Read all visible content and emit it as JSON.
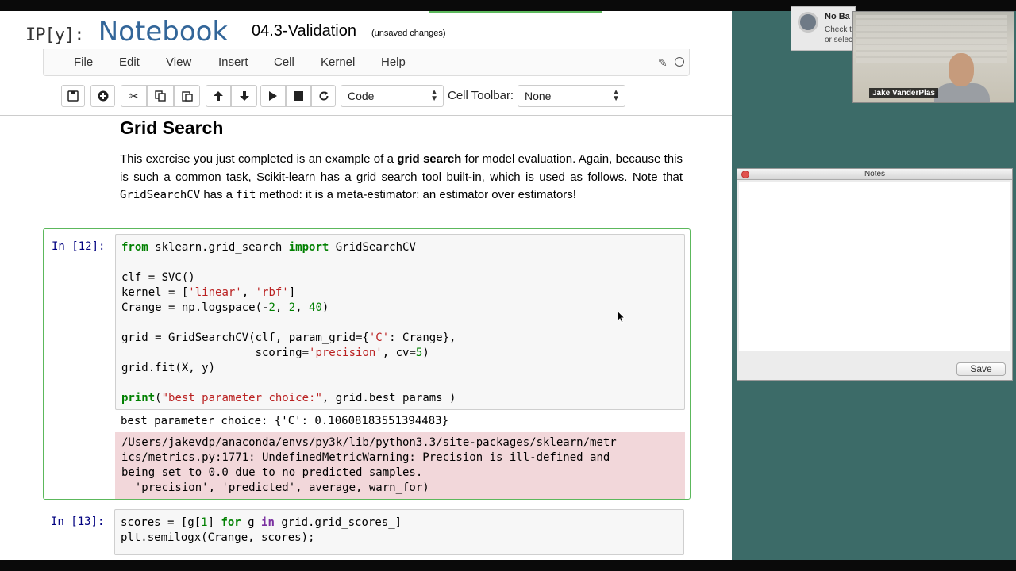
{
  "notebook": {
    "logo_ipy": "IP[y]:",
    "logo_word": "Notebook",
    "name": "04.3-Validation",
    "status": "(unsaved changes)"
  },
  "menu": [
    "File",
    "Edit",
    "View",
    "Insert",
    "Cell",
    "Kernel",
    "Help"
  ],
  "toolbar": {
    "cell_type": "Code",
    "cell_toolbar_label": "Cell Toolbar:",
    "cell_toolbar_value": "None"
  },
  "markdown": {
    "heading": "Grid Search",
    "p1_a": "This exercise you just completed is an example of a ",
    "p1_b": "grid search",
    "p1_c": " for model evaluation. Again, because this is such a common task, Scikit-learn has a grid search tool built-in, which is used as follows. Note that ",
    "p1_d": "GridSearchCV",
    "p1_e": " has a ",
    "p1_f": "fit",
    "p1_g": " method: it is a meta-estimator: an estimator over estimators!"
  },
  "cell12": {
    "prompt": "In [12]:",
    "l1_kw": "from",
    "l1_a": " sklearn.grid_search ",
    "l1_kw2": "import",
    "l1_b": " GridSearchCV",
    "l3": "clf = SVC()",
    "l4_a": "kernel = [",
    "l4_s1": "'linear'",
    "l4_b": ", ",
    "l4_s2": "'rbf'",
    "l4_c": "]",
    "l5_a": "Crange = np.logspace(-",
    "l5_n1": "2",
    "l5_b": ", ",
    "l5_n2": "2",
    "l5_c": ", ",
    "l5_n3": "40",
    "l5_d": ")",
    "l7_a": "grid = GridSearchCV(clf, param_grid={",
    "l7_s": "'C'",
    "l7_b": ": Crange},",
    "l8_a": "                    scoring=",
    "l8_s": "'precision'",
    "l8_b": ", cv=",
    "l8_n": "5",
    "l8_c": ")",
    "l9": "grid.fit(X, y)",
    "l11_kw": "print",
    "l11_a": "(",
    "l11_s": "\"best parameter choice:\"",
    "l11_b": ", grid.best_params_)",
    "output": "best parameter choice: {'C': 0.10608183551394483}",
    "stderr": [
      "/Users/jakevdp/anaconda/envs/py3k/lib/python3.3/site-packages/sklearn/metr",
      "ics/metrics.py:1771: UndefinedMetricWarning: Precision is ill-defined and",
      "being set to 0.0 due to no predicted samples.",
      "  'precision', 'predicted', average, warn_for)"
    ]
  },
  "cell13": {
    "prompt": "In [13]:",
    "l1_a": "scores = [g[",
    "l1_n": "1",
    "l1_b": "] ",
    "l1_kw": "for",
    "l1_c": " g ",
    "l1_kw2": "in",
    "l1_d": " grid.grid_scores_]",
    "l2": "plt.semilogx(Crange, scores);"
  },
  "notification": {
    "title": "No Ba",
    "line1": "Check t",
    "line2": "or selec"
  },
  "webcam": {
    "label": "Jake VanderPlas"
  },
  "notes": {
    "title": "Notes",
    "save": "Save"
  }
}
